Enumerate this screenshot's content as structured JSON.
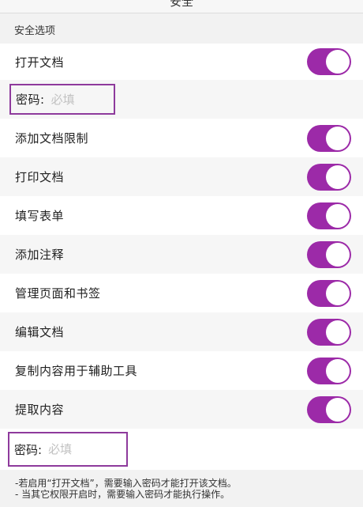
{
  "header": {
    "title": "安全"
  },
  "section": {
    "title": "安全选项"
  },
  "open_doc": {
    "label": "打开文档",
    "enabled": true
  },
  "password_open": {
    "label": "密码:",
    "placeholder": "必填",
    "value": ""
  },
  "permissions": [
    {
      "label": "添加文档限制",
      "enabled": true
    },
    {
      "label": "打印文档",
      "enabled": true
    },
    {
      "label": "填写表单",
      "enabled": true
    },
    {
      "label": "添加注释",
      "enabled": true
    },
    {
      "label": "管理页面和书签",
      "enabled": true
    },
    {
      "label": "编辑文档",
      "enabled": true
    },
    {
      "label": "复制内容用于辅助工具",
      "enabled": true
    },
    {
      "label": "提取内容",
      "enabled": true
    }
  ],
  "password_permissions": {
    "label": "密码:",
    "placeholder": "必填",
    "value": ""
  },
  "notes": [
    "-若启用“打开文档”，需要输入密码才能打开该文档。",
    "- 当其它权限开启时，需要输入密码才能执行操作。"
  ],
  "colors": {
    "accent": "#9c2aa8",
    "border": "#8e3a9c"
  }
}
